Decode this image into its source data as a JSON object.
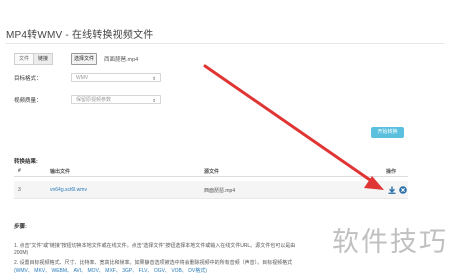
{
  "page": {
    "title": "MP4转WMV - 在线转换视频文件"
  },
  "upload": {
    "modes": [
      "文件",
      "链接"
    ],
    "active_mode": "链接",
    "choose_file_label": "选择文件",
    "file_name": "西面琵琶.mp4"
  },
  "form": {
    "target_format_label": "目标格式：",
    "target_format_value": "WMV",
    "video_quality_label": "视频质量：",
    "video_quality_value": "保留原视频参数",
    "start_button": "开始转换"
  },
  "results": {
    "label": "转换结果:",
    "headers": [
      "#",
      "输出文件",
      "源文件",
      "操作"
    ],
    "rows": [
      {
        "index": "3",
        "output_file": "vn64g.sct6l.wmv",
        "source_file": "西面琵琶.mp4"
      }
    ]
  },
  "steps": {
    "label": "步骤:",
    "line1": "1. 点击\"文件\"或\"链接\"按钮切换本地文件或在线文件。点击\"选择文件\"按钮选择本地文件或输入在线文件URL。源文件也可以是由",
    "line2": "200M)",
    "line3": "2. 设置目标视频格式、尺寸、比特率、宽高比和帧率。如果静音选项被选中将会删除视频中的所有音频（声音）。目标视频格式",
    "line4": "(WMV、 MKV、 WEBM、 AVI、 MOV、 MXF、 3GP、 FLV、 OGV、 VOB、 DV格式)"
  },
  "watermark": {
    "text": "软件技巧"
  },
  "colors": {
    "accent": "#5bc0de",
    "link": "#2a7ab8",
    "arrow": "#e03535"
  }
}
